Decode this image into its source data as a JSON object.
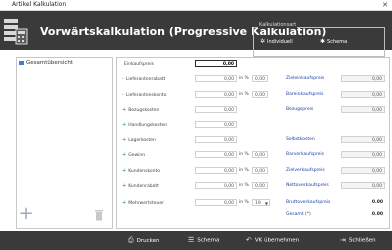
{
  "window": {
    "title": "Artikel Kalkulation",
    "close": "✕"
  },
  "header": {
    "title": "Vorwärtskalkulation (Progressive Kalkulation)",
    "kalkulationsart": {
      "legend": "Kalkulationsart",
      "options": [
        {
          "label": "Individuell",
          "selected": true
        },
        {
          "label": "Schema",
          "selected": false
        }
      ]
    }
  },
  "tree": {
    "root_label": "Gesamtübersicht"
  },
  "rows": [
    {
      "label": "Einkaufspreis",
      "marker": "",
      "value": "0,00",
      "pct": "",
      "pctval": "",
      "right_label": "",
      "right_value": ""
    },
    {
      "label": "Lieferantenrabatt",
      "marker": "-",
      "value": "0,00",
      "pct": "in %",
      "pctval": "0,00",
      "right_label": "Zieleinkaufspreis",
      "right_value": "0,00"
    },
    {
      "label": "Lieferantenskonto",
      "marker": "-",
      "value": "0,00",
      "pct": "in %",
      "pctval": "0,00",
      "right_label": "Bareinkaufspreis",
      "right_value": "0,00"
    },
    {
      "label": "Bezugskosten",
      "marker": "+",
      "value": "0,00",
      "pct": "",
      "pctval": "",
      "right_label": "Bezugspreis",
      "right_value": "0,00"
    },
    {
      "label": "Handlungskosten",
      "marker": "+",
      "value": "0,00",
      "pct": "",
      "pctval": "",
      "right_label": "",
      "right_value": ""
    },
    {
      "label": "Lagerkosten",
      "marker": "+",
      "value": "0,00",
      "pct": "",
      "pctval": "",
      "right_label": "Selbstkosten",
      "right_value": "0,00"
    },
    {
      "label": "Gewinn",
      "marker": "+",
      "value": "0,00",
      "pct": "in %",
      "pctval": "0,00",
      "right_label": "Barverkaufspreis",
      "right_value": "0,00"
    },
    {
      "label": "Kundenskonto",
      "marker": "+",
      "value": "0,00",
      "pct": "in %",
      "pctval": "0,00",
      "right_label": "Zielverkaufspreis",
      "right_value": "0,00"
    },
    {
      "label": "Kundenrabatt",
      "marker": "+",
      "value": "0,00",
      "pct": "in %",
      "pctval": "0,00",
      "right_label": "Nettoverkaufspreis",
      "right_value": "0,00"
    },
    {
      "label": "Mehrwertsteuer",
      "marker": "+",
      "value": "0,00",
      "pct": "in %",
      "pctval": "19",
      "right_label": "Bruttoverkaufspreis",
      "right_value": "0.00"
    }
  ],
  "gesamt": {
    "label": "Gesamt (*)",
    "value": "0.00"
  },
  "footer": {
    "drucken": "Drucken",
    "schema": "Schema",
    "vk_uebernehmen": "VK übernehmen",
    "schliessen": "Schließen"
  }
}
